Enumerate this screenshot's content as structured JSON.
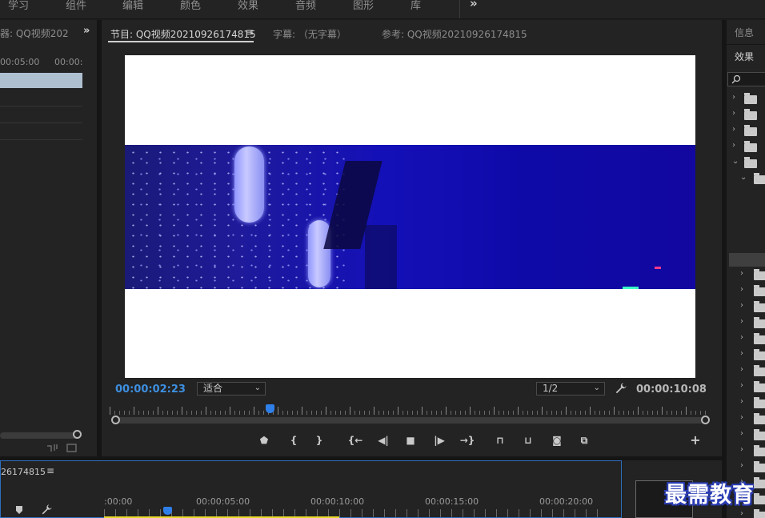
{
  "workspaces": [
    "学习",
    "组件",
    "编辑",
    "颜色",
    "效果",
    "音频",
    "图形",
    "库"
  ],
  "workspace_more": "»",
  "source": {
    "title": "器: QQ视频202",
    "more": "»",
    "timecodes": [
      "00:05:00",
      "00:00:"
    ]
  },
  "program": {
    "tab_label": "节目: QQ视频20210926174815",
    "tab_menu": "≡",
    "captions_tab": "字幕: （无字幕）",
    "reference_tab": "参考: QQ视频20210926174815",
    "current_timecode": "00:00:02:23",
    "zoom_fit": "适合",
    "resolution": "1/2",
    "duration_timecode": "00:00:10:08",
    "playhead_fraction": 0.26
  },
  "controls": {
    "add_marker": "⬟",
    "mark_in": "{",
    "mark_out": "}",
    "go_to_in": "{←",
    "step_back": "◀|",
    "stop": "■",
    "step_forward": "|▶",
    "go_to_out": "→}",
    "lift": "⊓",
    "extract": "⊔",
    "export_frame": "◙",
    "compare": "⧉",
    "add_button": "+"
  },
  "timeline": {
    "sequence_title": "26174815",
    "menu": "≡",
    "timecodes": [
      ":00:00",
      "00:00:05:00",
      "00:00:10:00",
      "00:00:15:00",
      "00:00:20:00"
    ]
  },
  "right_panel": {
    "info_tab": "信息",
    "effects_tab": "效果"
  },
  "watermark": "最需教育",
  "colors": {
    "accent": "#3d8fe0",
    "panel_bg": "#232323",
    "timeline_border": "#2e6fbf",
    "work_area": "#e8d82a"
  }
}
